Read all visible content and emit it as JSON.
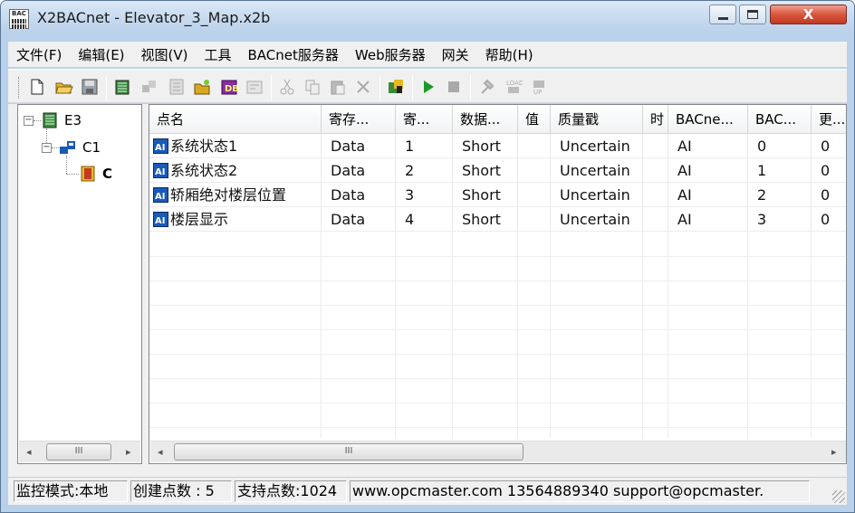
{
  "window": {
    "title": "X2BACnet - Elevator_3_Map.x2b",
    "icon_text": "BAC",
    "close_glyph": "X"
  },
  "menu": [
    "文件(F)",
    "编辑(E)",
    "视图(V)",
    "工具",
    "BACnet服务器",
    "Web服务器",
    "网关",
    "帮助(H)"
  ],
  "toolbar": {
    "icons": [
      "new-file-icon",
      "open-folder-icon",
      "save-icon",
      "device-icon",
      "channel-icon",
      "tag-icon",
      "new-tag-icon",
      "db-icon",
      "properties-icon",
      "cut-icon",
      "copy-icon",
      "paste-icon",
      "delete-icon",
      "monitor-icon",
      "run-icon",
      "stop-icon",
      "tools-icon",
      "load-icon",
      "unload-icon"
    ]
  },
  "tree": {
    "root": "E3",
    "channel": "C1",
    "device": "C"
  },
  "table": {
    "columns": [
      "点名",
      "寄存...",
      "寄...",
      "数据...",
      "值",
      "质量戳",
      "时",
      "BACne...",
      "BAC...",
      "更..."
    ],
    "rows": [
      [
        "系统状态1",
        "Data",
        "1",
        "Short",
        "",
        "Uncertain",
        "",
        "AI",
        "0",
        "0"
      ],
      [
        "系统状态2",
        "Data",
        "2",
        "Short",
        "",
        "Uncertain",
        "",
        "AI",
        "1",
        "0"
      ],
      [
        "轿厢绝对楼层位置",
        "Data",
        "3",
        "Short",
        "",
        "Uncertain",
        "",
        "AI",
        "2",
        "0"
      ],
      [
        "楼层显示",
        "Data",
        "4",
        "Short",
        "",
        "Uncertain",
        "",
        "AI",
        "3",
        "0"
      ]
    ]
  },
  "scroll": {
    "thumb_glyph": "III",
    "left_arrow": "◂",
    "right_arrow": "▸"
  },
  "status": {
    "mode": "监控模式:本地",
    "created": "创建点数 : 5",
    "supported": "支持点数:1024",
    "contact": "www.opcmaster.com 13564889340 support@opcmaster."
  },
  "colors": {
    "titlebar": "#c4d8ee",
    "close_button": "#c94a32",
    "chrome": "#f0f0f0",
    "run_green": "#1a9a2a"
  }
}
